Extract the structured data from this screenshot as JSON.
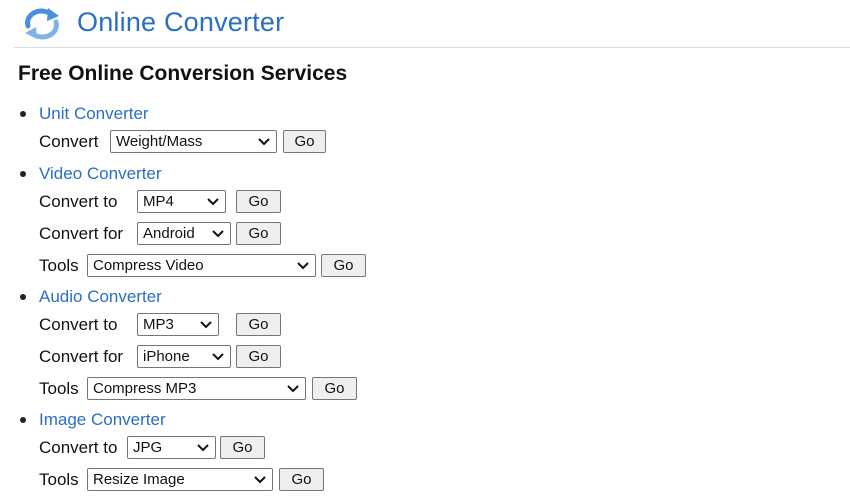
{
  "header": {
    "site_title": "Online Converter",
    "logo_icon": "refresh-arrows-icon"
  },
  "page": {
    "title": "Free Online Conversion Services"
  },
  "sections": [
    {
      "name": "Unit Converter",
      "rows": [
        {
          "label": "Convert",
          "select": "Weight/Mass",
          "go": "Go"
        }
      ]
    },
    {
      "name": "Video Converter",
      "rows": [
        {
          "label": "Convert to",
          "select": "MP4",
          "go": "Go"
        },
        {
          "label": "Convert for",
          "select": "Android",
          "go": "Go"
        },
        {
          "label": "Tools",
          "select": "Compress Video",
          "go": "Go"
        }
      ]
    },
    {
      "name": "Audio Converter",
      "rows": [
        {
          "label": "Convert to",
          "select": "MP3",
          "go": "Go"
        },
        {
          "label": "Convert for",
          "select": "iPhone",
          "go": "Go"
        },
        {
          "label": "Tools",
          "select": "Compress MP3",
          "go": "Go"
        }
      ]
    },
    {
      "name": "Image Converter",
      "rows": [
        {
          "label": "Convert to",
          "select": "JPG",
          "go": "Go"
        },
        {
          "label": "Tools",
          "select": "Resize Image",
          "go": "Go"
        }
      ]
    }
  ],
  "colors": {
    "link": "#2a6fc4",
    "logo": "#4a8fd8"
  }
}
